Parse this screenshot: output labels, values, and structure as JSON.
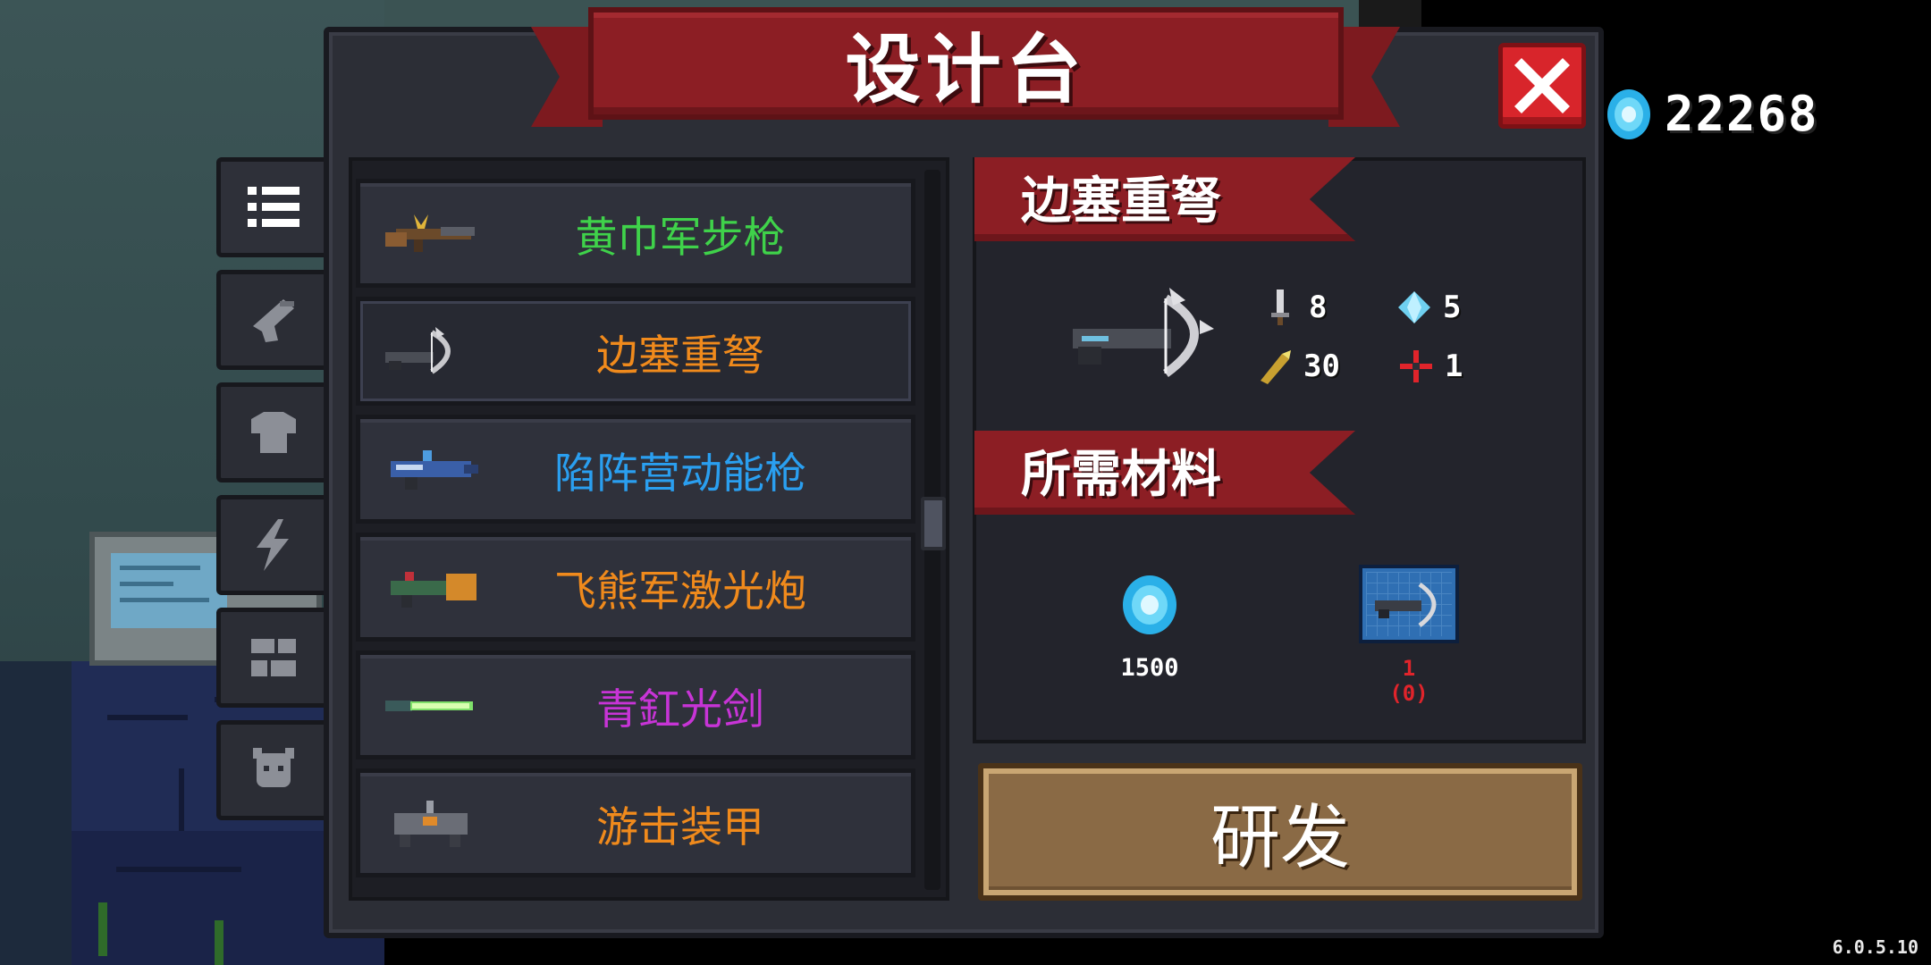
{
  "title": "设计台",
  "currency": {
    "icon": "gem-icon",
    "amount": "22268"
  },
  "tabs": [
    {
      "name": "list-icon",
      "active": true
    },
    {
      "name": "gun-icon",
      "active": false
    },
    {
      "name": "armor-icon",
      "active": false
    },
    {
      "name": "lightning-icon",
      "active": false
    },
    {
      "name": "parts-icon",
      "active": false
    },
    {
      "name": "pet-icon",
      "active": false
    }
  ],
  "items": [
    {
      "name": "黄巾军步枪",
      "color": "#3fd24a",
      "icon": "rifle-icon"
    },
    {
      "name": "边塞重弩",
      "color": "#f08a1c",
      "icon": "crossbow-icon",
      "selected": true
    },
    {
      "name": "陷阵营动能枪",
      "color": "#2a9ff0",
      "icon": "energy-gun-icon"
    },
    {
      "name": "飞熊军激光炮",
      "color": "#f08a1c",
      "icon": "laser-cannon-icon"
    },
    {
      "name": "青釭光剑",
      "color": "#c734d6",
      "icon": "lightsaber-icon"
    },
    {
      "name": "游击装甲",
      "color": "#f08a1c",
      "icon": "mech-armor-icon"
    }
  ],
  "detail": {
    "name": "边塞重弩",
    "stats": [
      {
        "icon": "sword-icon",
        "value": "8"
      },
      {
        "icon": "energy-crystal-icon",
        "value": "5"
      },
      {
        "icon": "bullet-icon",
        "value": "30"
      },
      {
        "icon": "crosshair-icon",
        "value": "1"
      }
    ]
  },
  "materials": {
    "header": "所需材料",
    "gem_cost": "1500",
    "blueprint_required": "1",
    "blueprint_owned": "(0)"
  },
  "research_label": "研发",
  "version": "6.0.5.10"
}
